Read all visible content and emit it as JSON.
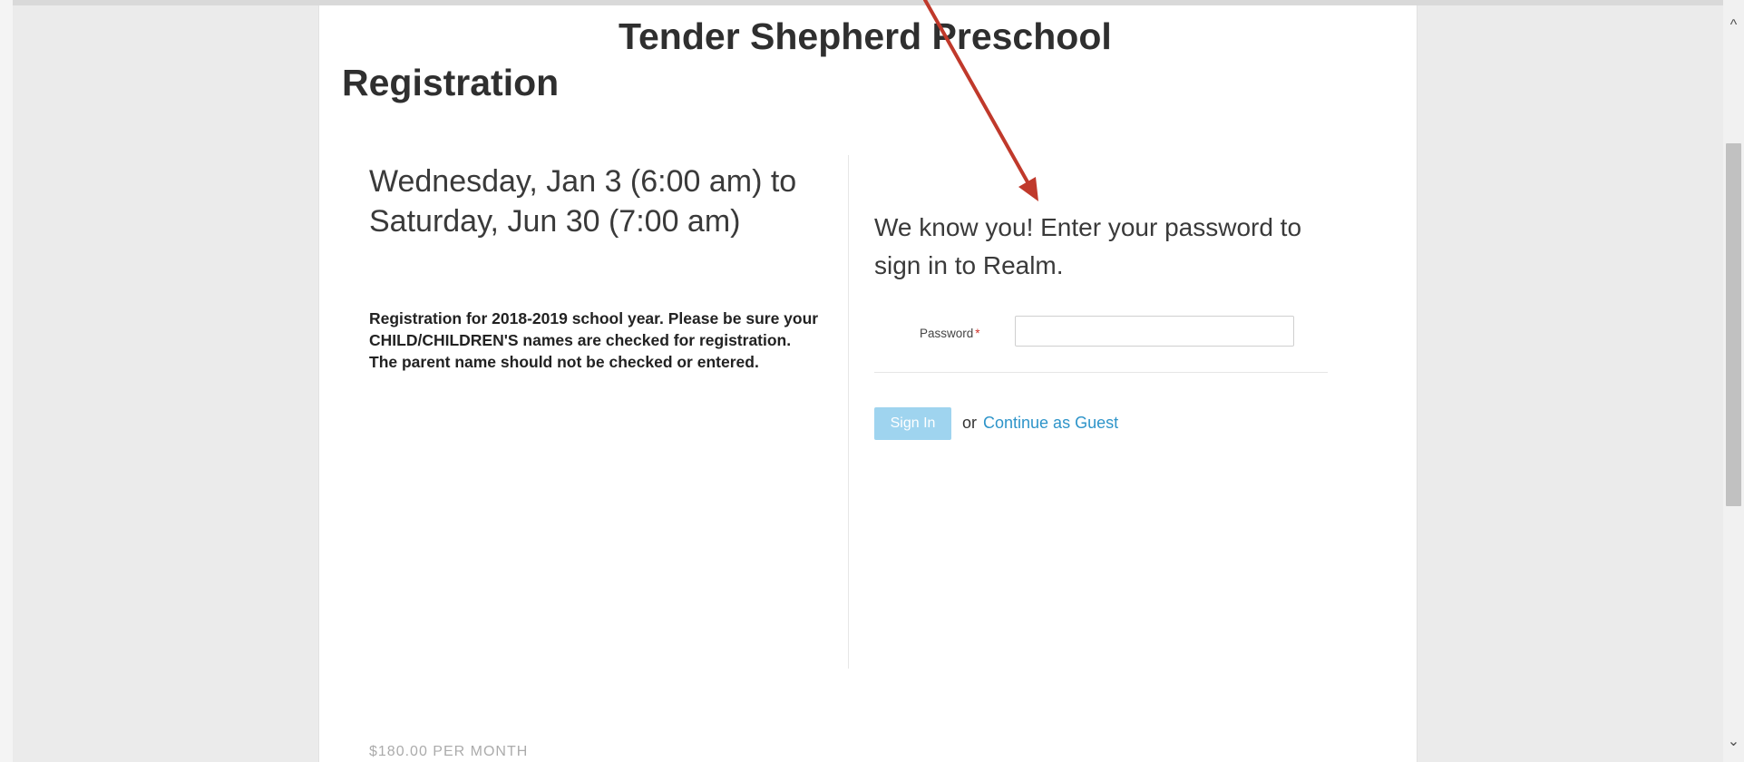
{
  "page": {
    "title_line1": "Tender Shepherd Preschool",
    "title_line2": "Registration"
  },
  "event": {
    "dates": "Wednesday, Jan 3 (6:00 am) to Saturday, Jun 30 (7:00 am)",
    "description": "Registration for 2018-2019 school year. Please be sure your CHILD/CHILDREN'S names are checked for registration. The parent name should not be checked or entered."
  },
  "signin": {
    "heading": "We know you! Enter your password to sign in to Realm.",
    "password_label": "Password",
    "required_marker": "*",
    "password_value": "",
    "sign_in_label": "Sign In",
    "or_text": "or",
    "guest_link": "Continue as Guest"
  },
  "footer": {
    "cutoff_text": "$180.00 PER MONTH"
  },
  "colors": {
    "annotation_arrow": "#c0392b",
    "sign_in_button": "#9fd4ef",
    "link": "#2e94c9"
  },
  "icons": {
    "scroll_up": "^",
    "scroll_down": "⌄"
  }
}
